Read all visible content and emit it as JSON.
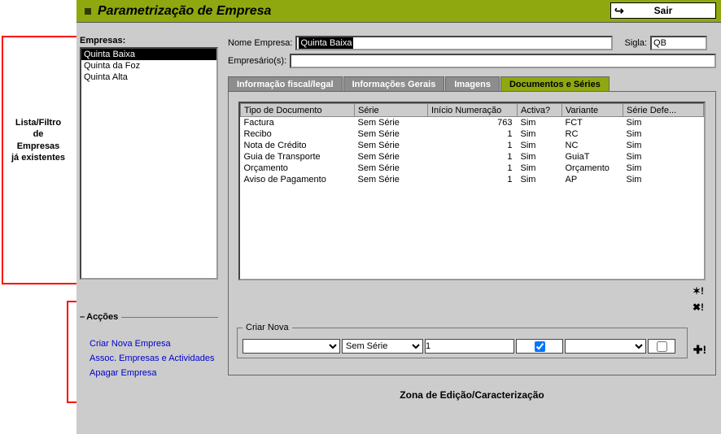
{
  "header": {
    "title": "Parametrização de Empresa",
    "exit_label": "Sair"
  },
  "annotations": {
    "left_label_l1": "Lista/Filtro",
    "left_label_l2": "de",
    "left_label_l3": "Empresas",
    "left_label_l4": "já existentes",
    "zone_label": "Zona de Edição/Caracterização"
  },
  "sidebar": {
    "label": "Empresas:",
    "items": [
      {
        "name": "Quinta Baixa",
        "selected": true
      },
      {
        "name": "Quinta da Foz",
        "selected": false
      },
      {
        "name": "Quinta Alta",
        "selected": false
      }
    ]
  },
  "actions": {
    "label": "Acções",
    "links": [
      "Criar Nova Empresa",
      "Assoc. Empresas e Actividades",
      "Apagar Empresa"
    ]
  },
  "edit": {
    "nome_label": "Nome Empresa:",
    "nome_value": "Quinta Baixa",
    "sigla_label": "Sigla:",
    "sigla_value": "QB",
    "empresario_label": "Empresário(s):",
    "empresario_value": ""
  },
  "tabs": [
    {
      "label": "Informação fiscal/legal",
      "active": false
    },
    {
      "label": "Informações Gerais",
      "active": false
    },
    {
      "label": "Imagens",
      "active": false
    },
    {
      "label": "Documentos e Séries",
      "active": true
    }
  ],
  "table": {
    "headers": [
      "Tipo de Documento",
      "Série",
      "Início Numeração",
      "Activa?",
      "Variante",
      "Série Defe..."
    ],
    "rows": [
      {
        "tipo": "Factura",
        "serie": "Sem Série",
        "inicio": "763",
        "activa": "Sim",
        "variante": "FCT",
        "defeito": "Sim"
      },
      {
        "tipo": "Recibo",
        "serie": "Sem Série",
        "inicio": "1",
        "activa": "Sim",
        "variante": "RC",
        "defeito": "Sim"
      },
      {
        "tipo": "Nota de Crédito",
        "serie": "Sem Série",
        "inicio": "1",
        "activa": "Sim",
        "variante": "NC",
        "defeito": "Sim"
      },
      {
        "tipo": "Guia de Transporte",
        "serie": "Sem Série",
        "inicio": "1",
        "activa": "Sim",
        "variante": "GuiaT",
        "defeito": "Sim"
      },
      {
        "tipo": "Orçamento",
        "serie": "Sem Série",
        "inicio": "1",
        "activa": "Sim",
        "variante": "Orçamento",
        "defeito": "Sim"
      },
      {
        "tipo": "Aviso de Pagamento",
        "serie": "Sem Série",
        "inicio": "1",
        "activa": "Sim",
        "variante": "AP",
        "defeito": "Sim"
      }
    ]
  },
  "criar_nova": {
    "legend": "Criar Nova",
    "tipo_value": "",
    "serie_value": "Sem Série",
    "inicio_value": "1",
    "activa_checked": true,
    "variante_value": "",
    "defeito_checked": false
  }
}
